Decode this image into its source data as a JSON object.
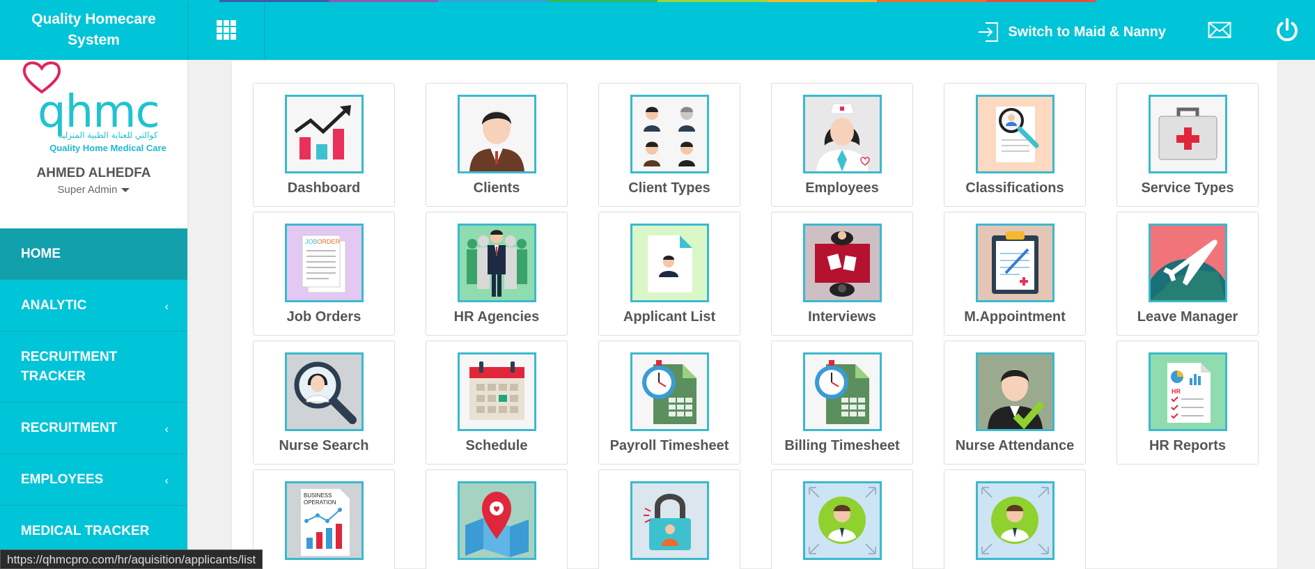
{
  "colors": {
    "accent": "#00c4d8",
    "nav_active": "#11a0ac",
    "icon_border": "#3ab9ce"
  },
  "topbar": {
    "brand": "Quality Homecare System",
    "apps_icon": "grid-icon",
    "switch_label": "Switch to Maid & Nanny",
    "switch_icon": "sign-in-icon",
    "mail_icon": "mail-icon",
    "power_icon": "power-icon"
  },
  "sidebar": {
    "logo": {
      "text": "qhmc",
      "arabic": "كوالتي للعناية الطبية المنزلية",
      "subtitle": "Quality Home Medical Care"
    },
    "user": {
      "name": "AHMED ALHEDFA",
      "role": "Super Admin"
    },
    "nav": [
      {
        "label": "HOME",
        "chevron": false,
        "active": true
      },
      {
        "label": "ANALYTIC",
        "chevron": true,
        "active": false
      },
      {
        "label": "RECRUITMENT TRACKER",
        "chevron": false,
        "active": false
      },
      {
        "label": "RECRUITMENT",
        "chevron": true,
        "active": false
      },
      {
        "label": "EMPLOYEES",
        "chevron": true,
        "active": false
      },
      {
        "label": "MEDICAL TRACKER",
        "chevron": false,
        "active": false
      }
    ]
  },
  "tiles": [
    {
      "label": "Dashboard",
      "icon": "chart-growth-icon",
      "bg": "#f6f6f6"
    },
    {
      "label": "Clients",
      "icon": "client-person-icon",
      "bg": "#f6f6f6"
    },
    {
      "label": "Client Types",
      "icon": "people-group-icon",
      "bg": "#f6f6f6"
    },
    {
      "label": "Employees",
      "icon": "nurse-icon",
      "bg": "#e8e8e8"
    },
    {
      "label": "Classifications",
      "icon": "document-search-icon",
      "bg": "#fcd9c0"
    },
    {
      "label": "Service Types",
      "icon": "first-aid-kit-icon",
      "bg": "#f6f6f6"
    },
    {
      "label": "Job Orders",
      "icon": "job-order-icon",
      "bg": "#e2c8f3"
    },
    {
      "label": "HR Agencies",
      "icon": "businessman-group-icon",
      "bg": "#8fdcae"
    },
    {
      "label": "Applicant List",
      "icon": "applicant-file-icon",
      "bg": "#daf7c8"
    },
    {
      "label": "Interviews",
      "icon": "interview-table-icon",
      "bg": "#cdbfc3"
    },
    {
      "label": "M.Appointment",
      "icon": "clipboard-icon",
      "bg": "#e3c6b6"
    },
    {
      "label": "Leave Manager",
      "icon": "airplane-icon",
      "bg": "#f0747a"
    },
    {
      "label": "Nurse Search",
      "icon": "nurse-search-icon",
      "bg": "#cfd3d6"
    },
    {
      "label": "Schedule",
      "icon": "calendar-icon",
      "bg": "#f6f6f6"
    },
    {
      "label": "Payroll Timesheet",
      "icon": "timesheet-icon",
      "bg": "#f6f6f6"
    },
    {
      "label": "Billing Timesheet",
      "icon": "timesheet-icon",
      "bg": "#f6f6f6"
    },
    {
      "label": "Nurse Attendance",
      "icon": "attendance-check-icon",
      "bg": "#9ba98f"
    },
    {
      "label": "HR Reports",
      "icon": "hr-report-icon",
      "bg": "#8fdcae"
    },
    {
      "label": "",
      "icon": "business-operation-icon",
      "bg": "#cfd3d6"
    },
    {
      "label": "",
      "icon": "map-pin-icon",
      "bg": "#a6d2c2"
    },
    {
      "label": "",
      "icon": "lock-user-icon",
      "bg": "#dbe6ee"
    },
    {
      "label": "",
      "icon": "user-expand-icon",
      "bg": "#cde4f4"
    },
    {
      "label": "",
      "icon": "user-expand-icon",
      "bg": "#cde4f4"
    }
  ],
  "status_bar": {
    "url": "https://qhmcpro.com/hr/aquisition/applicants/list"
  }
}
